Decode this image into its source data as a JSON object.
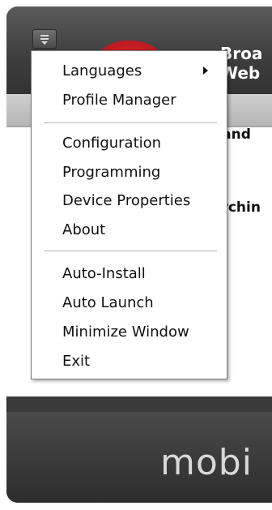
{
  "app": {
    "title_line1": "Broa",
    "title_line2": "Web",
    "band_label": "band",
    "status_text": "archin",
    "footer_logo": "mobi"
  },
  "menu": {
    "groups": [
      [
        {
          "label": "Languages",
          "has_submenu": true
        },
        {
          "label": "Profile Manager"
        }
      ],
      [
        {
          "label": "Configuration"
        },
        {
          "label": "Programming"
        },
        {
          "label": "Device Properties"
        },
        {
          "label": "About"
        }
      ],
      [
        {
          "label": "Auto-Install"
        },
        {
          "label": "Auto Launch"
        },
        {
          "label": "Minimize Window"
        },
        {
          "label": "Exit"
        }
      ]
    ]
  },
  "colors": {
    "brand_red": "#c8202a",
    "frame": "#3a3a3a",
    "menu_bg": "#ffffff"
  },
  "icons": {
    "menu_button": "hamburger-dropdown-icon",
    "submenu_arrow": "caret-right-icon"
  }
}
